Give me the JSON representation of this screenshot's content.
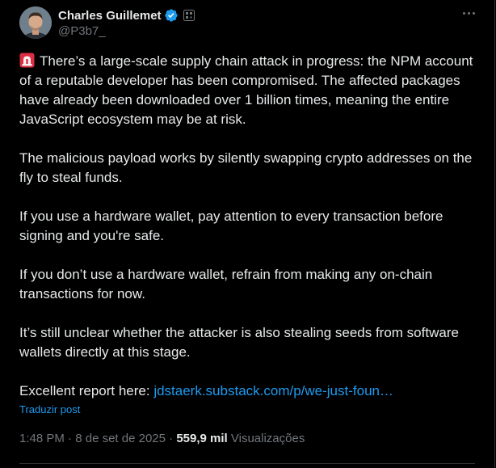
{
  "author": {
    "display_name": "Charles Guillemet",
    "handle": "@P3b7_",
    "verified_color": "#1d9bf0"
  },
  "icons": {
    "more": "more-horizontal-icon",
    "verified": "verified-badge-icon",
    "affiliate": "qr-affiliate-badge-icon",
    "siren": "siren-emoji-icon"
  },
  "tweet": {
    "p1": "There’s a large-scale supply chain attack in progress: the NPM account of a reputable developer has been compromised. The affected packages have already been downloaded over 1 billion times, meaning the entire JavaScript ecosystem may be at risk.",
    "p2": "The malicious payload works by silently swapping crypto addresses on the fly to steal funds.",
    "p3": "If you use a hardware wallet, pay attention to every transaction before signing and you're safe.",
    "p4": "If you don’t use a hardware wallet, refrain from making any on-chain transactions for now.",
    "p5": "It’s still unclear whether the attacker is also stealing seeds from software wallets directly at this stage.",
    "p6_prefix": "Excellent report here: ",
    "p6_link": "jdstaerk.substack.com/p/we-just-foun…"
  },
  "translate_label": "Traduzir post",
  "meta": {
    "time": "1:48 PM",
    "sep1": " · ",
    "date": "8 de set de 2025",
    "sep2": " · ",
    "views_count": "559,9 mil",
    "views_label": " Visualizações"
  },
  "colors": {
    "background": "#000000",
    "text": "#e7e9ea",
    "muted": "#71767b",
    "accent": "#1d9bf0"
  }
}
